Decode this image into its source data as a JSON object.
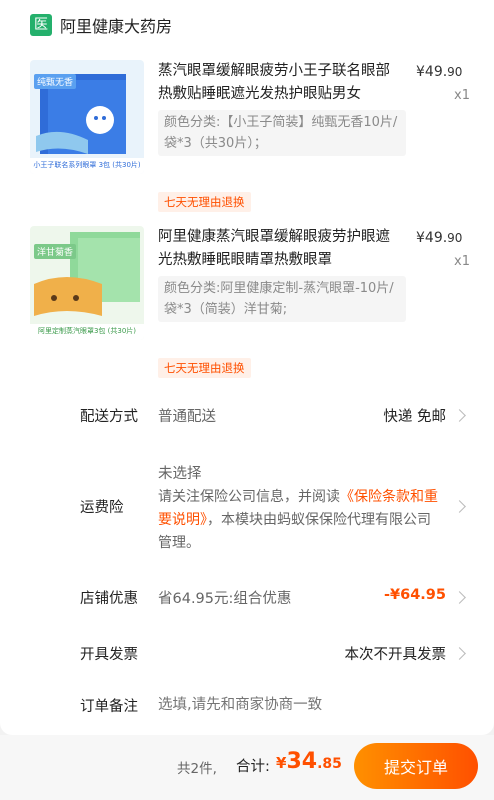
{
  "shop": {
    "icon": "医",
    "name": "阿里健康大药房"
  },
  "items": [
    {
      "title": "蒸汽眼罩缓解眼疲劳小王子联名眼部热敷贴睡眠遮光发热护眼贴男女",
      "price_int": "¥49.",
      "price_dec": "90",
      "qty": "x1",
      "spec": "颜色分类:【小王子简装】纯甄无香10片/袋*3（共30片）；",
      "tag": "七天无理由退换",
      "thumb_label": "纯甄无香",
      "thumb_caption": "小王子联名系列眼罩 3包 (共30片)",
      "thumb_color": "#2f6cd8"
    },
    {
      "title": "阿里健康蒸汽眼罩缓解眼疲劳护眼遮光热敷睡眠眼睛罩热敷眼罩",
      "price_int": "¥49.",
      "price_dec": "90",
      "qty": "x1",
      "spec": "颜色分类:阿里健康定制-蒸汽眼罩-10片/袋*3（简装）洋甘菊;",
      "tag": "七天无理由退换",
      "thumb_label": "洋甘菊香",
      "thumb_caption": "阿里定制蒸汽眼罩3包 (共30片)",
      "thumb_color": "#8fd99a"
    }
  ],
  "delivery": {
    "label": "配送方式",
    "value": "普通配送",
    "right": "快递 免邮"
  },
  "insurance": {
    "label": "运费险",
    "status": "未选择",
    "text_a": "请关注保险公司信息，并阅读",
    "link": "《保险条款和重要说明》",
    "text_b": "，本模块由蚂蚁保保险代理有限公司管理。"
  },
  "discount": {
    "label": "店铺优惠",
    "value": "省64.95元:组合优惠",
    "amount": "-¥64.95"
  },
  "invoice": {
    "label": "开具发票",
    "value": "本次不开具发票"
  },
  "remark": {
    "label": "订单备注",
    "placeholder": "选填,请先和商家协商一致"
  },
  "footer": {
    "count": "共2件,",
    "total_label": "合计:",
    "total_cur": "¥",
    "total_int": "34",
    "total_dec": ".85",
    "submit": "提交订单"
  },
  "colors": {
    "accent": "#ff5000",
    "shop_icon": "#24b06c"
  }
}
